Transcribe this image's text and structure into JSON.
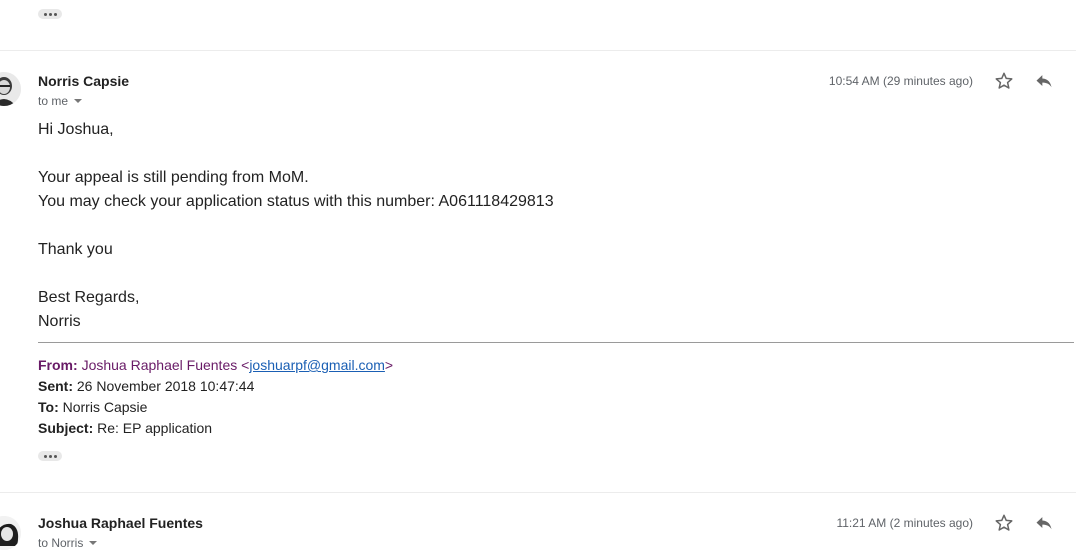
{
  "thread": {
    "messages": [
      {
        "sender": "Norris Capsie",
        "recipient_label": "to me",
        "time": "10:54 AM (29 minutes ago)",
        "body": {
          "greeting": "Hi Joshua,",
          "line1": "Your appeal is still pending from MoM.",
          "line2": "You may check your application status with this number: A061118429813",
          "thanks": "Thank you",
          "regards": "Best Regards,",
          "signature": "Norris"
        },
        "quoted": {
          "from_label": "From:",
          "from_name": "Joshua Raphael Fuentes",
          "from_email": "joshuarpf@gmail.com",
          "sent_label": "Sent:",
          "sent_value": "26 November 2018 10:47:44",
          "to_label": "To:",
          "to_value": "Norris Capsie",
          "subject_label": "Subject:",
          "subject_value": "Re: EP application"
        }
      },
      {
        "sender": "Joshua Raphael Fuentes",
        "recipient_label": "to Norris",
        "time": "11:21 AM (2 minutes ago)"
      }
    ]
  },
  "icons": {
    "star": "star-icon",
    "reply": "reply-icon",
    "more": "ellipsis-icon"
  },
  "colors": {
    "from_line": "#681a66",
    "link": "#1a5fb4",
    "muted": "#5f6368"
  }
}
